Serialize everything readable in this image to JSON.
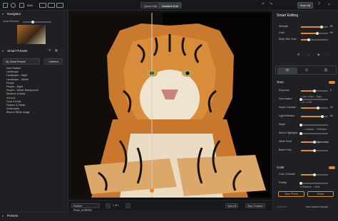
{
  "topbar": {
    "zoom": "66%",
    "tabs": [
      "Quick Edit",
      "Detailed Edit"
    ],
    "save_label": "Save All",
    "accent": "#e08a2a"
  },
  "left": {
    "navigator_title": "Navigator",
    "zoom_label": "Zoom Percent",
    "smart_presets_title": "Smart Presets",
    "preset_select": "My Smart Presets",
    "preset_button": "Unlinked",
    "preset_items": [
      "Auto Radiant",
      "Landscape",
      "Landscape – Night",
      "Landscape – Winter",
      "People",
      "People – Night",
      "People – Winter Background",
      "Newborn & Baby",
      "Animals",
      "Food & Drink",
      "Flowers & Plants",
      "Underwater",
      "Black & White Image"
    ],
    "highlighted_index": 8,
    "presets_footer": "Presets"
  },
  "status": {
    "filename": "Radiant Photo_SCREEN",
    "page": "1 of 1",
    "sync_all": "Sync All",
    "sync_forward": "Sync Forward"
  },
  "right": {
    "title": "Smart Editing",
    "smart_sliders": [
      {
        "label": "Strength",
        "value": "80",
        "pct": 0.75
      },
      {
        "label": "Color",
        "value": "60",
        "pct": 0.6
      },
      {
        "label": "Deep Skin Tone",
        "value": "",
        "pct": 0.3
      }
    ],
    "tone_title": "Tone",
    "tone_sliders": [
      {
        "label": "Exposure",
        "value": "0",
        "pct": 0.5
      },
      {
        "label": "Face Aware",
        "value": "",
        "pct": 0
      },
      {
        "label": "Super Contrast",
        "value": "30",
        "pct": 0.62
      },
      {
        "label": "Light Diffusion",
        "value": "60",
        "pct": 0.8
      },
      {
        "label": "Depth",
        "value": "",
        "pct": 0
      },
      {
        "label": "Skin & Highlights",
        "value": "",
        "pct": 0
      },
      {
        "label": "White Point",
        "value": "",
        "pct": 0.5
      },
      {
        "label": "Black Point",
        "value": "",
        "pct": 0.5
      }
    ],
    "color_title": "Color",
    "color_sliders": [
      {
        "label": "Color Contrast",
        "value": "",
        "pct": 0.5
      },
      {
        "label": "Fidelity",
        "value": "",
        "pct": 0
      }
    ],
    "save_preset": "Save Preset",
    "reset": "Reset",
    "version": "v1.3.0.197",
    "manager": "Open Radiant Manager"
  }
}
